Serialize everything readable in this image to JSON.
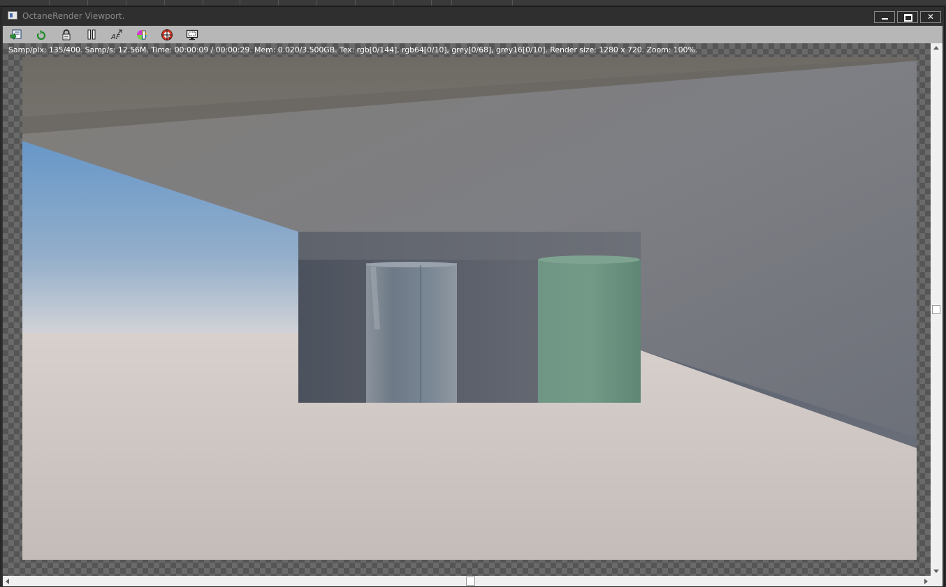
{
  "window": {
    "title": "OctaneRender Viewport."
  },
  "toolbar": {
    "buttons": [
      {
        "name": "export-render-button",
        "icon": "save-render-icon"
      },
      {
        "name": "restart-render-button",
        "icon": "refresh-icon"
      },
      {
        "name": "lock-viewport-button",
        "icon": "lock-icon"
      },
      {
        "name": "pause-render-button",
        "icon": "pause-icon"
      },
      {
        "name": "autofocus-button",
        "icon": "af-icon"
      },
      {
        "name": "color-picker-button",
        "icon": "color-palette-icon"
      },
      {
        "name": "pick-focus-button",
        "icon": "target-icon"
      },
      {
        "name": "region-render-button",
        "icon": "monitor-icon"
      }
    ]
  },
  "status": {
    "text": "Samp/pix: 135/400.   Samp/s: 12.56M.   Time: 00:00:09 / 00:00:29.   Mem: 0.020/3.500GB.   Tex: rgb[0/144], rgb64[0/10], grey[0/68], grey16[0/10].   Render size: 1280 x 720.   Zoom: 100%."
  },
  "render": {
    "width": 1280,
    "height": 720,
    "colors": {
      "sky_top": "#6f9fcc",
      "floor": "#cfc8c4",
      "ceiling": "#6e6b66",
      "wall": "#7a7c82",
      "alcove_dark": "#4a4f5a",
      "cylinder_green": "#6e9480",
      "glass": "#7b8694"
    }
  },
  "colors": {
    "toolbar_bg": "#b7b7b7",
    "titlebar_bg": "#2f2f2f",
    "scrollbar_bg": "#f0f0f0"
  }
}
